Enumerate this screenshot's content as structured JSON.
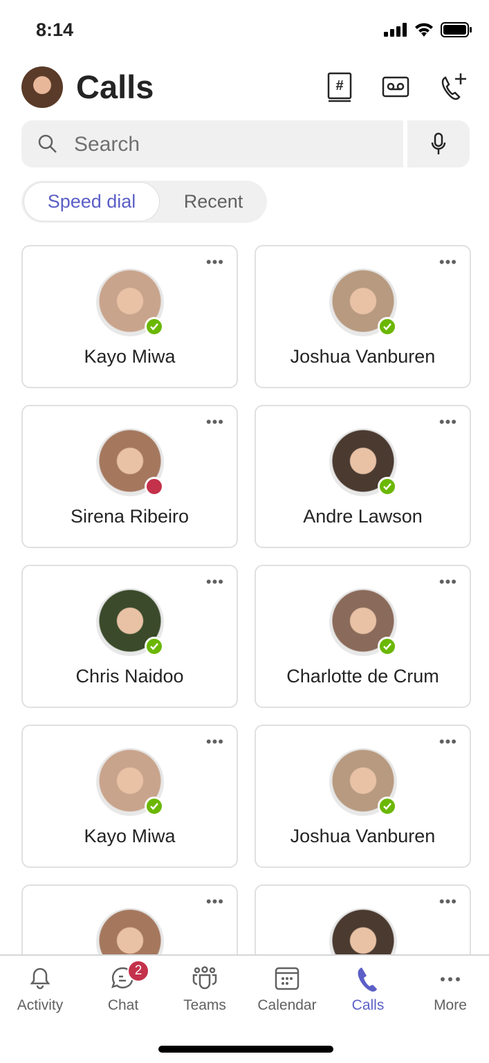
{
  "status_bar": {
    "time": "8:14"
  },
  "header": {
    "title": "Calls",
    "icons": [
      "dialpad-book-icon",
      "voicemail-icon",
      "add-call-icon"
    ]
  },
  "search": {
    "placeholder": "Search",
    "mic_icon": "microphone-icon"
  },
  "segments": [
    {
      "label": "Speed dial",
      "selected": true
    },
    {
      "label": "Recent",
      "selected": false
    }
  ],
  "colors": {
    "accent": "#5b5fc7",
    "available": "#6bb700",
    "busy": "#c4314b"
  },
  "contacts": [
    {
      "name": "Kayo Miwa",
      "status": "available"
    },
    {
      "name": "Joshua Vanburen",
      "status": "available"
    },
    {
      "name": "Sirena Ribeiro",
      "status": "busy"
    },
    {
      "name": "Andre Lawson",
      "status": "available"
    },
    {
      "name": "Chris Naidoo",
      "status": "available"
    },
    {
      "name": "Charlotte de Crum",
      "status": "available"
    },
    {
      "name": "Kayo Miwa",
      "status": "available"
    },
    {
      "name": "Joshua Vanburen",
      "status": "available"
    },
    {
      "name": "",
      "status": ""
    },
    {
      "name": "",
      "status": ""
    }
  ],
  "tabs": [
    {
      "label": "Activity",
      "icon": "bell-icon"
    },
    {
      "label": "Chat",
      "icon": "chat-icon",
      "badge": "2"
    },
    {
      "label": "Teams",
      "icon": "teams-icon"
    },
    {
      "label": "Calendar",
      "icon": "calendar-icon"
    },
    {
      "label": "Calls",
      "icon": "phone-icon",
      "active": true
    },
    {
      "label": "More",
      "icon": "more-icon"
    }
  ]
}
